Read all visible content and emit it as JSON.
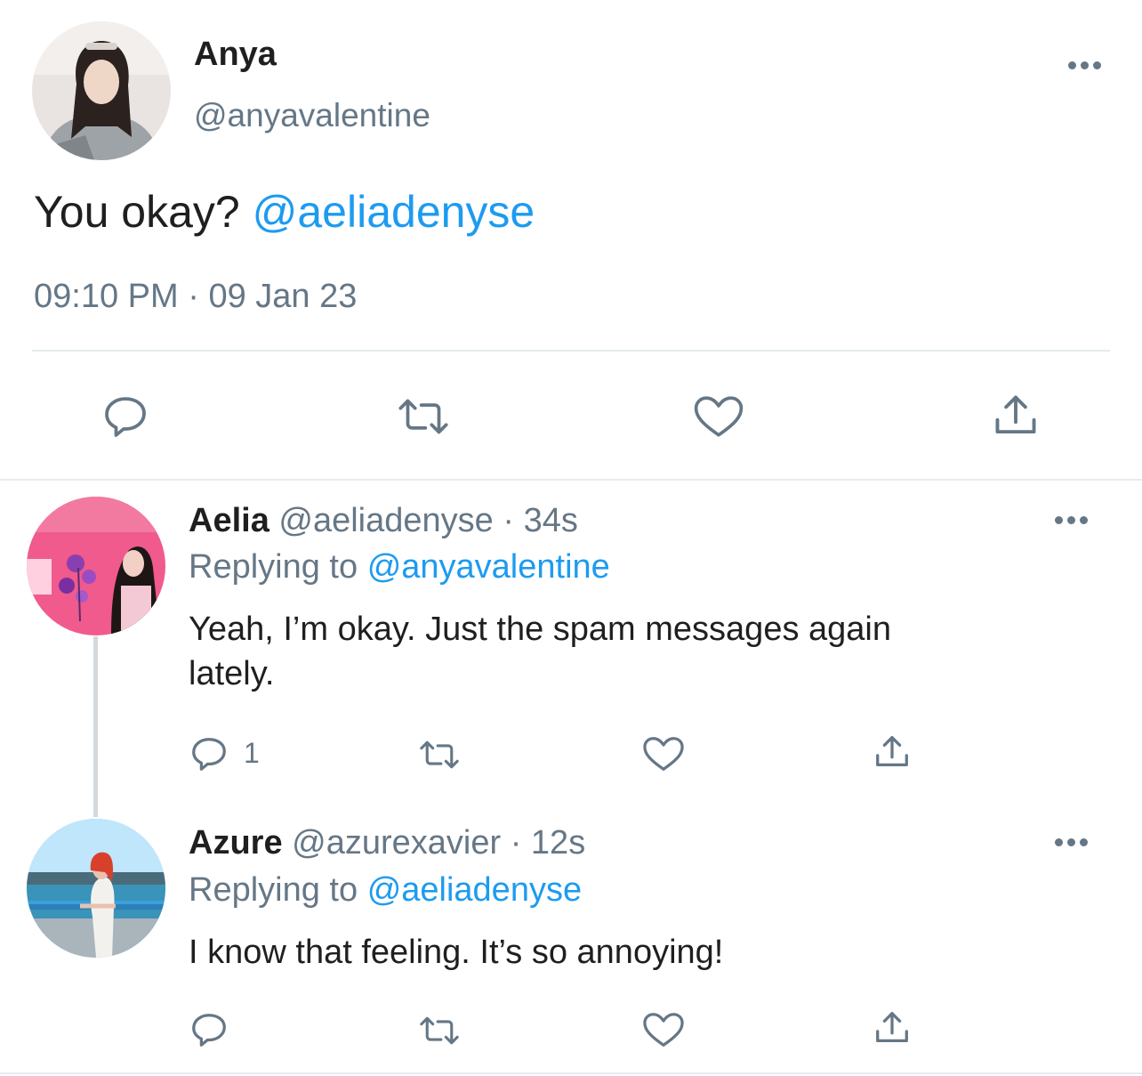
{
  "main_tweet": {
    "author_name": "Anya",
    "author_handle": "@anyavalentine",
    "text": "You okay?",
    "mention": "@aeliadenyse",
    "time": "09:10 PM",
    "separator": "·",
    "date": "09 Jan 23"
  },
  "replies": [
    {
      "author_name": "Aelia",
      "author_handle": "@aeliadenyse",
      "dot": "·",
      "age": "34s",
      "replying_label": "Replying to",
      "replying_to": "@anyavalentine",
      "text_line1": "Yeah, I’m okay. Just the spam messages again",
      "text_line2": "lately.",
      "reply_count": "1"
    },
    {
      "author_name": "Azure",
      "author_handle": "@azurexavier",
      "dot": "·",
      "age": "12s",
      "replying_label": "Replying to",
      "replying_to": "@aeliadenyse",
      "text": "I know that feeling. It’s so annoying!"
    }
  ],
  "icons": {
    "reply": "speech-bubble-icon",
    "retweet": "retweet-arrows-icon",
    "like": "heart-icon",
    "share": "share-upload-icon",
    "more": "more-options-icon"
  },
  "colors": {
    "accent": "#1d9bf0",
    "muted": "#657786",
    "divider": "#e6ecf0"
  }
}
